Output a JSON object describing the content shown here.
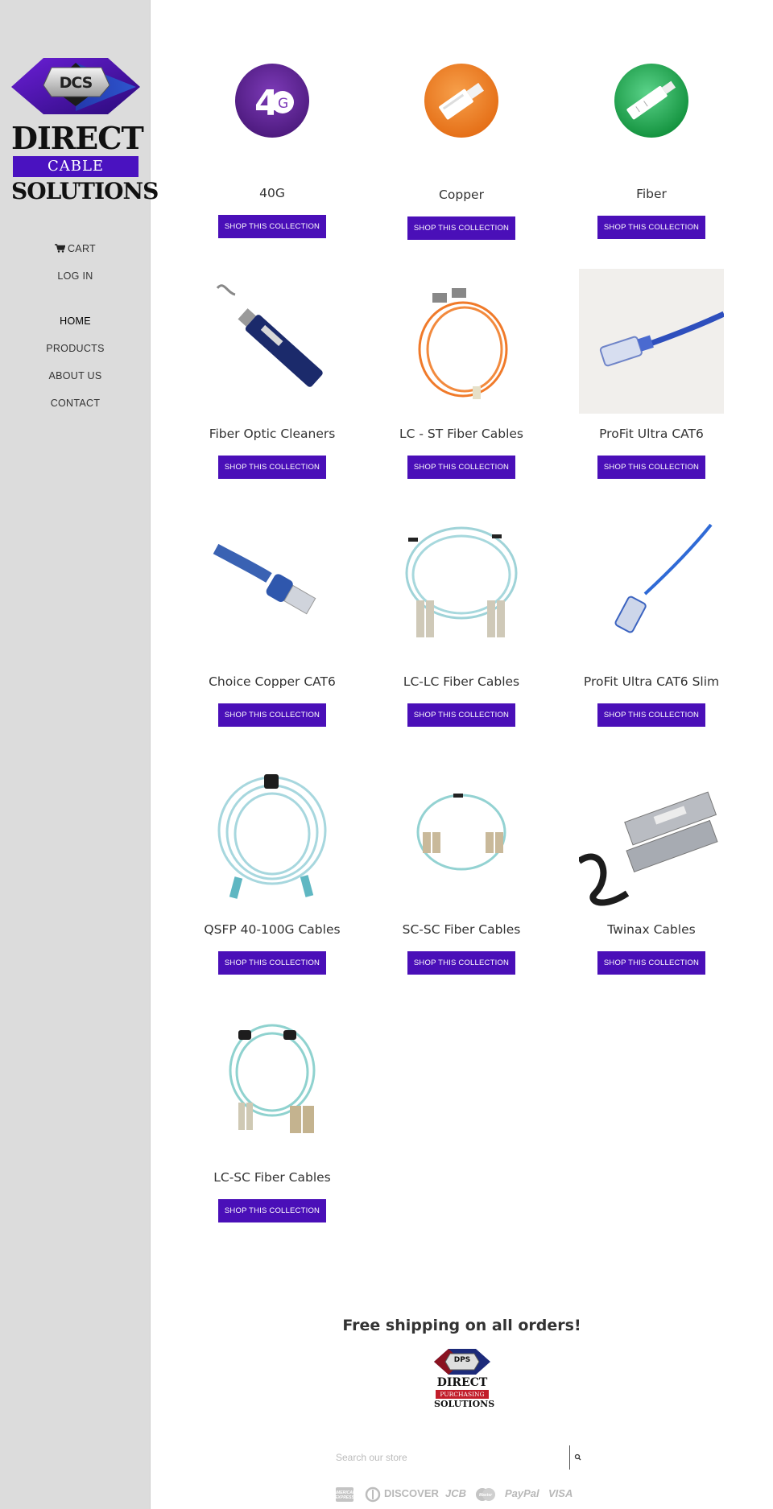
{
  "sidebar": {
    "logo": {
      "badge": "DCS",
      "line1": "DIRECT",
      "line2": "CABLE",
      "line3": "SOLUTIONS"
    },
    "nav": {
      "cart": "CART",
      "login": "LOG IN",
      "items": [
        "HOME",
        "PRODUCTS",
        "ABOUT US",
        "CONTACT"
      ]
    }
  },
  "collections": [
    {
      "title": "40G",
      "button": "SHOP THIS COLLECTION",
      "icon": "40g-icon",
      "color": "#6a2d9b"
    },
    {
      "title": "Copper",
      "button": "SHOP THIS COLLECTION",
      "icon": "copper-connector-icon",
      "color": "#ef7f22"
    },
    {
      "title": "Fiber",
      "button": "SHOP THIS COLLECTION",
      "icon": "fiber-connector-icon",
      "color": "#1aa54a"
    },
    {
      "title": "Fiber Optic Cleaners",
      "button": "SHOP THIS COLLECTION",
      "icon": "fiber-cleaner-image"
    },
    {
      "title": "LC - ST Fiber Cables",
      "button": "SHOP THIS COLLECTION",
      "icon": "orange-fiber-cable-image"
    },
    {
      "title": "ProFit Ultra CAT6",
      "button": "SHOP THIS COLLECTION",
      "icon": "blue-cat6-cable-image"
    },
    {
      "title": "Choice Copper CAT6",
      "button": "SHOP THIS COLLECTION",
      "icon": "blue-copper-cable-image"
    },
    {
      "title": "LC-LC Fiber Cables",
      "button": "SHOP THIS COLLECTION",
      "icon": "aqua-lc-lc-cable-image"
    },
    {
      "title": "ProFit Ultra CAT6 Slim",
      "button": "SHOP THIS COLLECTION",
      "icon": "slim-cat6-cable-image"
    },
    {
      "title": "QSFP 40-100G Cables",
      "button": "SHOP THIS COLLECTION",
      "icon": "qsfp-cable-image"
    },
    {
      "title": "SC-SC Fiber Cables",
      "button": "SHOP THIS COLLECTION",
      "icon": "sc-sc-cable-image"
    },
    {
      "title": "Twinax Cables",
      "button": "SHOP THIS COLLECTION",
      "icon": "twinax-cable-image"
    },
    {
      "title": "LC-SC Fiber Cables",
      "button": "SHOP THIS COLLECTION",
      "icon": "lc-sc-cable-image"
    }
  ],
  "footer": {
    "shipping": "Free shipping on all orders!",
    "dps_logo": {
      "badge": "DPS",
      "line1": "DIRECT",
      "line2": "PURCHASING",
      "line3": "SOLUTIONS"
    },
    "search": {
      "placeholder": "Search our store"
    },
    "payments": [
      "American Express",
      "Diners Club",
      "DISCOVER",
      "JCB",
      "Master",
      "PayPal",
      "VISA"
    ]
  },
  "colors": {
    "sidebar_bg": "#dcdcdc",
    "button_bg": "#4a0fb8",
    "brand_purple": "#4a12c0",
    "dps_red": "#c21d2a"
  }
}
